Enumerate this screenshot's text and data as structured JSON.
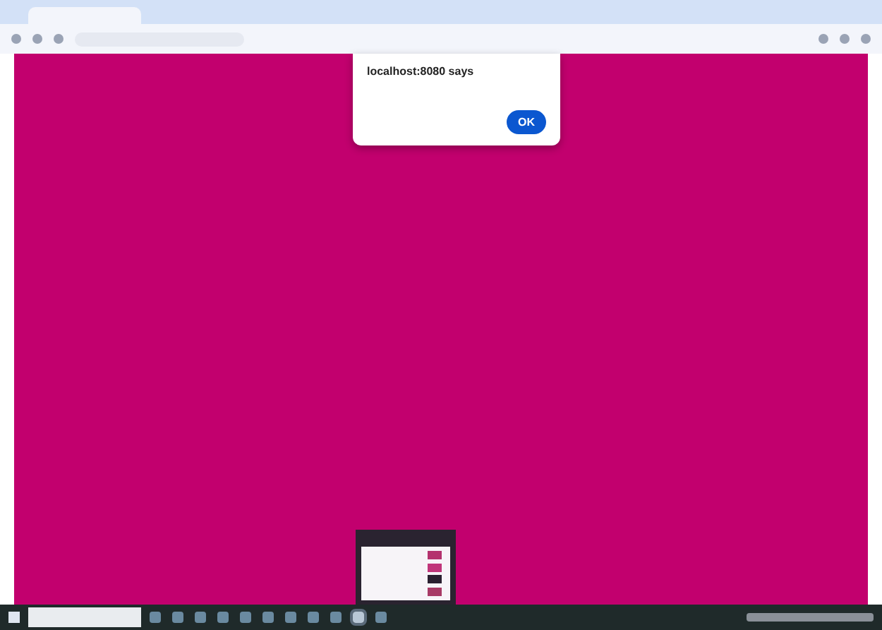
{
  "browser": {
    "tabs": [
      {
        "selected": true
      }
    ]
  },
  "dialog": {
    "title": "localhost:8080 says",
    "button": "OK"
  },
  "preview": {
    "swatches": [
      {
        "color": "#b4326e"
      },
      {
        "color": "#c0357a"
      },
      {
        "color": "#2a2030"
      },
      {
        "color": "#a83a66"
      }
    ]
  },
  "taskbar": {
    "apps": [
      {
        "selected": false
      },
      {
        "selected": false
      },
      {
        "selected": false
      },
      {
        "selected": false
      },
      {
        "selected": false
      },
      {
        "selected": false
      },
      {
        "selected": false
      },
      {
        "selected": false
      },
      {
        "selected": false
      },
      {
        "selected": true
      },
      {
        "selected": false
      }
    ]
  }
}
